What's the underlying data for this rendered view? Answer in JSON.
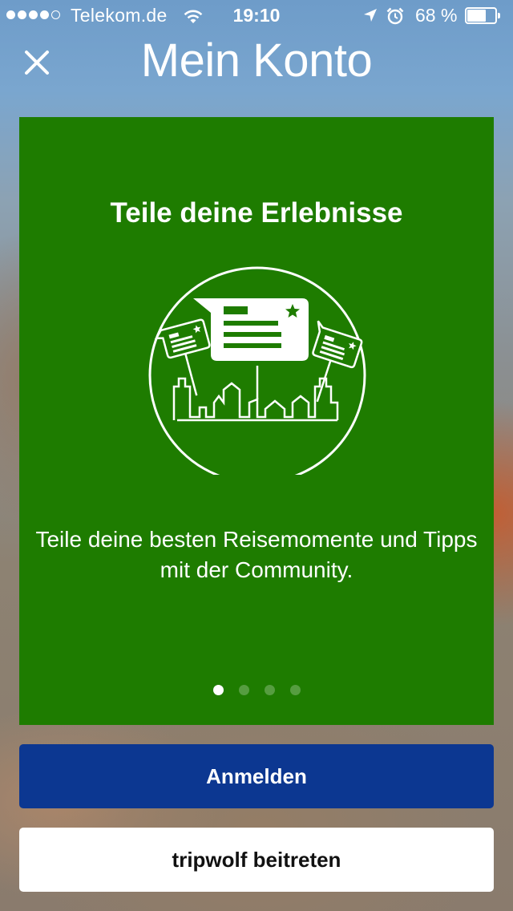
{
  "status_bar": {
    "carrier": "Telekom.de",
    "time": "19:10",
    "battery_percent": "68 %",
    "battery_level": 0.68,
    "signal_bars_filled": 4,
    "signal_bars_total": 5,
    "icons": [
      "wifi-icon",
      "location-arrow-icon",
      "alarm-clock-icon",
      "battery-icon"
    ]
  },
  "header": {
    "title": "Mein Konto",
    "close_icon": "close-icon"
  },
  "card": {
    "background_color": "#1e7c00",
    "title": "Teile deine Erlebnisse",
    "text": "Teile deine besten Reisemomente und Tipps mit der Community.",
    "illustration_icon": "city-share-icon",
    "pager": {
      "total": 4,
      "active_index": 0
    }
  },
  "buttons": {
    "login_label": "Anmelden",
    "login_color": "#0c3791",
    "join_label": "tripwolf beitreten"
  }
}
